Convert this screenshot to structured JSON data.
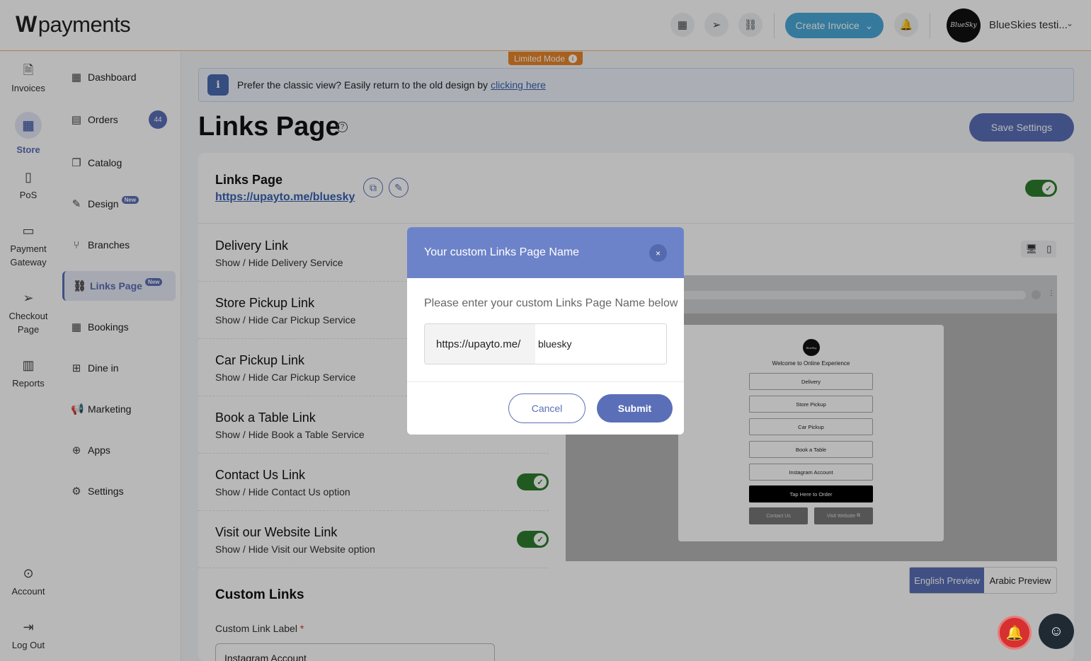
{
  "header": {
    "logo_text": "payments",
    "logo_mark": "W",
    "create_invoice_label": "Create Invoice",
    "user_name": "BlueSkies testi...",
    "avatar_text": "BlueSky",
    "icons": [
      "store-icon",
      "send-icon",
      "link-icon",
      "bell-icon"
    ]
  },
  "rail": {
    "items": [
      {
        "label": "Invoices",
        "icon": "invoice-icon"
      },
      {
        "label": "Store",
        "icon": "store-icon"
      },
      {
        "label": "PoS",
        "icon": "pos-icon"
      },
      {
        "label": "Payment Gateway",
        "icon": "card-icon"
      },
      {
        "label": "Checkout Page",
        "icon": "send-icon"
      },
      {
        "label": "Reports",
        "icon": "reports-icon"
      },
      {
        "label": "Account",
        "icon": "account-icon"
      },
      {
        "label": "Log Out",
        "icon": "logout-icon"
      }
    ]
  },
  "sidebar": {
    "items": [
      {
        "label": "Dashboard"
      },
      {
        "label": "Orders",
        "count": "44"
      },
      {
        "label": "Catalog"
      },
      {
        "label": "Design",
        "badge": "New"
      },
      {
        "label": "Branches"
      },
      {
        "label": "Links Page",
        "badge": "New"
      },
      {
        "label": "Bookings"
      },
      {
        "label": "Dine in"
      },
      {
        "label": "Marketing"
      },
      {
        "label": "Apps"
      },
      {
        "label": "Settings"
      }
    ]
  },
  "main": {
    "limited_mode": "Limited Mode",
    "banner_text": "Prefer the classic view? Easily return to the old design by",
    "banner_link": "clicking here",
    "page_title": "Links Page",
    "save_label": "Save Settings",
    "card_title": "Links Page",
    "card_url": "https://upayto.me/bluesky",
    "rows": [
      {
        "title": "Delivery Link",
        "sub": "Show / Hide Delivery Service"
      },
      {
        "title": "Store Pickup Link",
        "sub": "Show / Hide Car Pickup Service"
      },
      {
        "title": "Car Pickup Link",
        "sub": "Show / Hide Car Pickup Service"
      },
      {
        "title": "Book a Table Link",
        "sub": "Show / Hide Book a Table Service"
      },
      {
        "title": "Contact Us Link",
        "sub": "Show / Hide Contact Us option"
      },
      {
        "title": "Visit our Website Link",
        "sub": "Show / Hide Visit our Website option"
      }
    ],
    "custom_links_title": "Custom Links",
    "custom_link_label": "Custom Link Label",
    "custom_link_value": "Instagram Account"
  },
  "preview": {
    "logo_text": "BlueSky",
    "welcome": "Welcome to Online Experience",
    "buttons": [
      "Delivery",
      "Store Pickup",
      "Car Pickup",
      "Book a Table",
      "Instagram Account"
    ],
    "cta": "Tap Here to Order",
    "contact": "Contact Us",
    "website": "Visit Website",
    "lang_en": "English Preview",
    "lang_ar": "Arabic Preview"
  },
  "modal": {
    "title": "Your custom Links Page Name",
    "close": "×",
    "description": "Please enter your custom Links Page Name below",
    "url_prefix": "https://upayto.me/",
    "url_value": "bluesky",
    "cancel_label": "Cancel",
    "submit_label": "Submit"
  },
  "colors": {
    "accent": "#5b6fb8",
    "modal_header": "#6d83c9",
    "create_invoice": "#4aa9d9",
    "toggle_on": "#2f7d2f",
    "limited_mode": "#e8862a"
  }
}
